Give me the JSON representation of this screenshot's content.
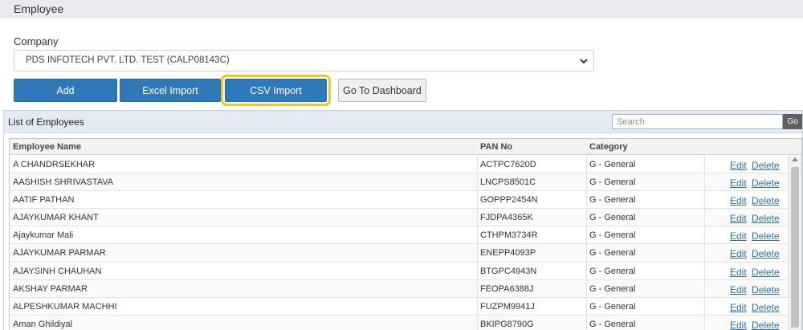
{
  "header": {
    "title": "Employee"
  },
  "company": {
    "label": "Company",
    "selected": "PDS INFOTECH PVT. LTD. TEST (CALP08143C)"
  },
  "actions": {
    "add": "Add",
    "excel_import": "Excel Import",
    "csv_import": "CSV Import",
    "dashboard": "Go To Dashboard"
  },
  "highlight_color": "#f3c623",
  "panel": {
    "title": "List of Employees",
    "search_placeholder": "Search",
    "go": "Go"
  },
  "table": {
    "columns": [
      "Employee Name",
      "PAN No",
      "Category"
    ],
    "edit_label": "Edit",
    "delete_label": "Delete",
    "rows": [
      {
        "name": "A CHANDRSEKHAR",
        "pan": "ACTPC7620D",
        "category": "G - General"
      },
      {
        "name": "AASHISH SHRIVASTAVA",
        "pan": "LNCPS8501C",
        "category": "G - General"
      },
      {
        "name": "AATIF PATHAN",
        "pan": "GOPPP2454N",
        "category": "G - General"
      },
      {
        "name": "AJAYKUMAR KHANT",
        "pan": "FJDPA4365K",
        "category": "G - General"
      },
      {
        "name": "Ajaykumar Mali",
        "pan": "CTHPM3734R",
        "category": "G - General"
      },
      {
        "name": "AJAYKUMAR PARMAR",
        "pan": "ENEPP4093P",
        "category": "G - General"
      },
      {
        "name": "AJAYSINH CHAUHAN",
        "pan": "BTGPC4943N",
        "category": "G - General"
      },
      {
        "name": "AKSHAY PARMAR",
        "pan": "FEOPA6388J",
        "category": "G - General"
      },
      {
        "name": "ALPESHKUMAR MACHHI",
        "pan": "FUZPM9941J",
        "category": "G - General"
      },
      {
        "name": "Aman Ghildiyal",
        "pan": "BKIPG8790G",
        "category": "G - General"
      }
    ]
  }
}
